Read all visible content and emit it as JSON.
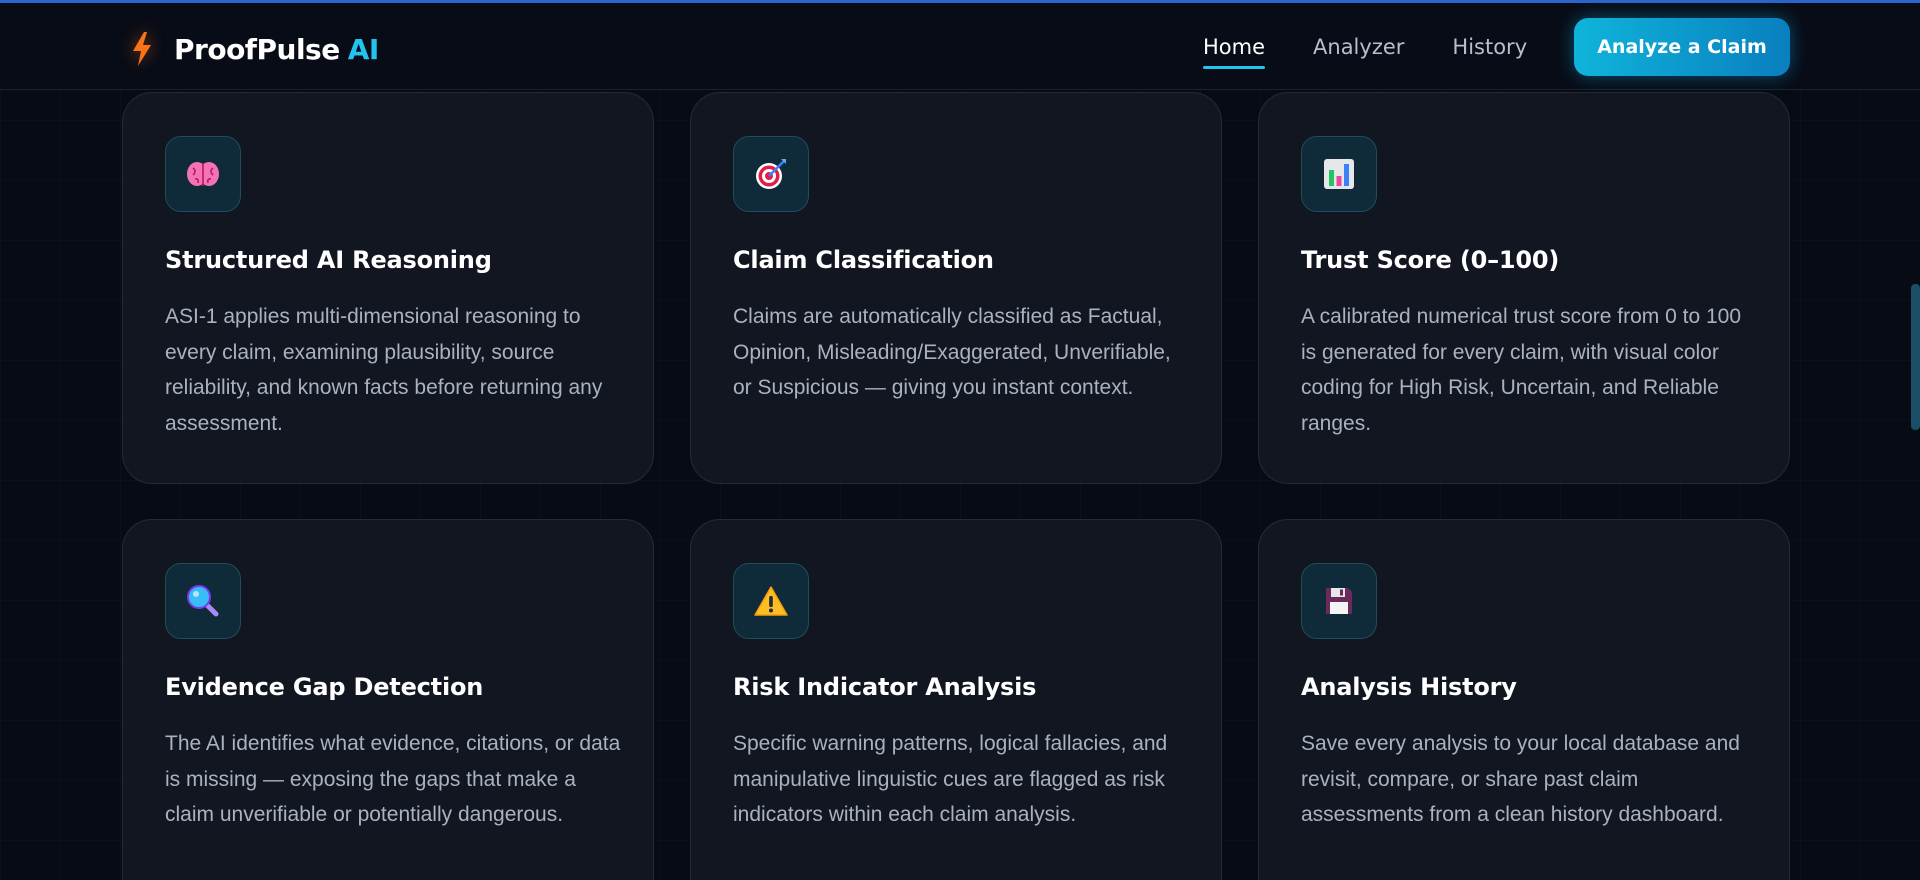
{
  "brand": {
    "name": "ProofPulse",
    "accent": "AI"
  },
  "nav": {
    "links": [
      {
        "label": "Home",
        "active": true
      },
      {
        "label": "Analyzer",
        "active": false
      },
      {
        "label": "History",
        "active": false
      }
    ],
    "cta_label": "Analyze a Claim"
  },
  "features": [
    {
      "icon": "brain-icon",
      "title": "Structured AI Reasoning",
      "description": "ASI-1 applies multi-dimensional reasoning to every claim, examining plausibility, source reliability, and known facts before returning any assessment."
    },
    {
      "icon": "target-icon",
      "title": "Claim Classification",
      "description": "Claims are automatically classified as Factual, Opinion, Misleading/Exaggerated, Unverifiable, or Suspicious — giving you instant context."
    },
    {
      "icon": "bar-chart-icon",
      "title": "Trust Score (0–100)",
      "description": "A calibrated numerical trust score from 0 to 100 is generated for every claim, with visual color coding for High Risk, Uncertain, and Reliable ranges."
    },
    {
      "icon": "magnifier-icon",
      "title": "Evidence Gap Detection",
      "description": "The AI identifies what evidence, citations, or data is missing — exposing the gaps that make a claim unverifiable or potentially dangerous."
    },
    {
      "icon": "warning-icon",
      "title": "Risk Indicator Analysis",
      "description": "Specific warning patterns, logical fallacies, and manipulative linguistic cues are flagged as risk indicators within each claim analysis."
    },
    {
      "icon": "floppy-disk-icon",
      "title": "Analysis History",
      "description": "Save every analysis to your local database and revisit, compare, or share past claim assessments from a clean history dashboard."
    }
  ],
  "colors": {
    "accent": "#22c3ee",
    "bolt": "#f97316",
    "background": "#070b14",
    "card": "#111621"
  }
}
